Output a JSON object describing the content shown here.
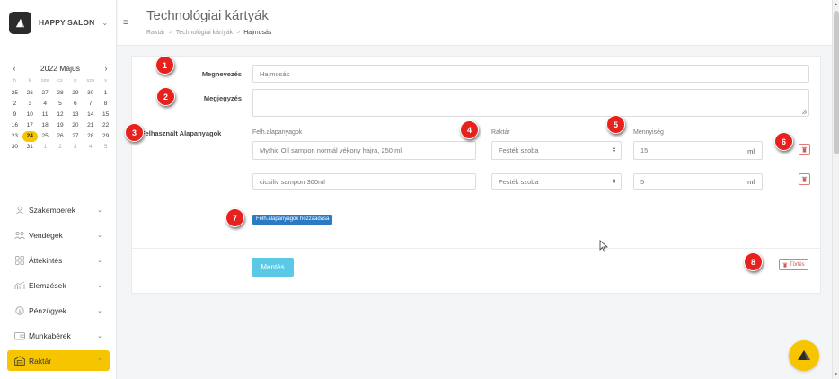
{
  "brand": {
    "name": "HAPPY SALON"
  },
  "calendar": {
    "month_label": "2022 Május",
    "weekdays": [
      "h",
      "k",
      "sze",
      "cs",
      "p",
      "szo",
      "v"
    ],
    "days": [
      {
        "d": "25",
        "muted": false
      },
      {
        "d": "26",
        "muted": false
      },
      {
        "d": "27",
        "muted": false
      },
      {
        "d": "28",
        "muted": false
      },
      {
        "d": "29",
        "muted": false
      },
      {
        "d": "30",
        "muted": false
      },
      {
        "d": "1",
        "muted": false
      },
      {
        "d": "2",
        "muted": false
      },
      {
        "d": "3",
        "muted": false
      },
      {
        "d": "4",
        "muted": false
      },
      {
        "d": "5",
        "muted": false
      },
      {
        "d": "6",
        "muted": false
      },
      {
        "d": "7",
        "muted": false
      },
      {
        "d": "8",
        "muted": false
      },
      {
        "d": "9",
        "muted": false
      },
      {
        "d": "10",
        "muted": false
      },
      {
        "d": "11",
        "muted": false
      },
      {
        "d": "12",
        "muted": false
      },
      {
        "d": "13",
        "muted": false
      },
      {
        "d": "14",
        "muted": false
      },
      {
        "d": "15",
        "muted": false
      },
      {
        "d": "16",
        "muted": false
      },
      {
        "d": "17",
        "muted": false
      },
      {
        "d": "18",
        "muted": false
      },
      {
        "d": "19",
        "muted": false
      },
      {
        "d": "20",
        "muted": false
      },
      {
        "d": "21",
        "muted": false
      },
      {
        "d": "22",
        "muted": false
      },
      {
        "d": "23",
        "muted": false
      },
      {
        "d": "24",
        "today": true
      },
      {
        "d": "25",
        "muted": false
      },
      {
        "d": "26",
        "muted": false
      },
      {
        "d": "27",
        "muted": false
      },
      {
        "d": "28",
        "muted": false
      },
      {
        "d": "29",
        "muted": false
      },
      {
        "d": "30",
        "muted": false
      },
      {
        "d": "31",
        "muted": false
      },
      {
        "d": "1",
        "muted": true
      },
      {
        "d": "2",
        "muted": true
      },
      {
        "d": "3",
        "muted": true
      },
      {
        "d": "4",
        "muted": true
      },
      {
        "d": "5",
        "muted": true
      }
    ]
  },
  "menu": [
    {
      "label": "Szakemberek",
      "icon": "person-icon"
    },
    {
      "label": "Vendégek",
      "icon": "guests-icon"
    },
    {
      "label": "Áttekintés",
      "icon": "grid-icon"
    },
    {
      "label": "Elemzések",
      "icon": "chart-icon"
    },
    {
      "label": "Pénzügyek",
      "icon": "coin-icon"
    },
    {
      "label": "Munkabérek",
      "icon": "wallet-icon"
    },
    {
      "label": "Raktár",
      "icon": "warehouse-icon",
      "active": true
    }
  ],
  "header": {
    "title": "Technológiai kártyák",
    "breadcrumb": [
      "Raktár",
      "Technológiai kártyák",
      "Hajmosás"
    ]
  },
  "form": {
    "name_label": "Megnevezés",
    "name_value": "Hajmosás",
    "note_label": "Megjegyzés",
    "note_value": "",
    "materials_label": "Felhasznált Alapanyagok",
    "col_material": "Felh.alapanyagok",
    "col_storage": "Raktár",
    "col_quantity": "Mennyiség",
    "rows": [
      {
        "material": "Mythic Oil sampon normál vékony hajra, 250 ml",
        "storage": "Festék szoba",
        "quantity": "15",
        "unit": "ml"
      },
      {
        "material": "cicsiliv sampon 300ml",
        "storage": "Festék szoba",
        "quantity": "5",
        "unit": "ml"
      }
    ],
    "add_button": "Felh.alapanyagok hozzáadása",
    "save_button": "Mentés",
    "delete_button": "Törlés"
  },
  "badges": [
    "1",
    "2",
    "3",
    "4",
    "5",
    "6",
    "7",
    "8"
  ],
  "colors": {
    "accent": "#f7c500",
    "primary": "#2a7bc4",
    "save": "#5bc8e6",
    "danger": "#e8211e"
  }
}
